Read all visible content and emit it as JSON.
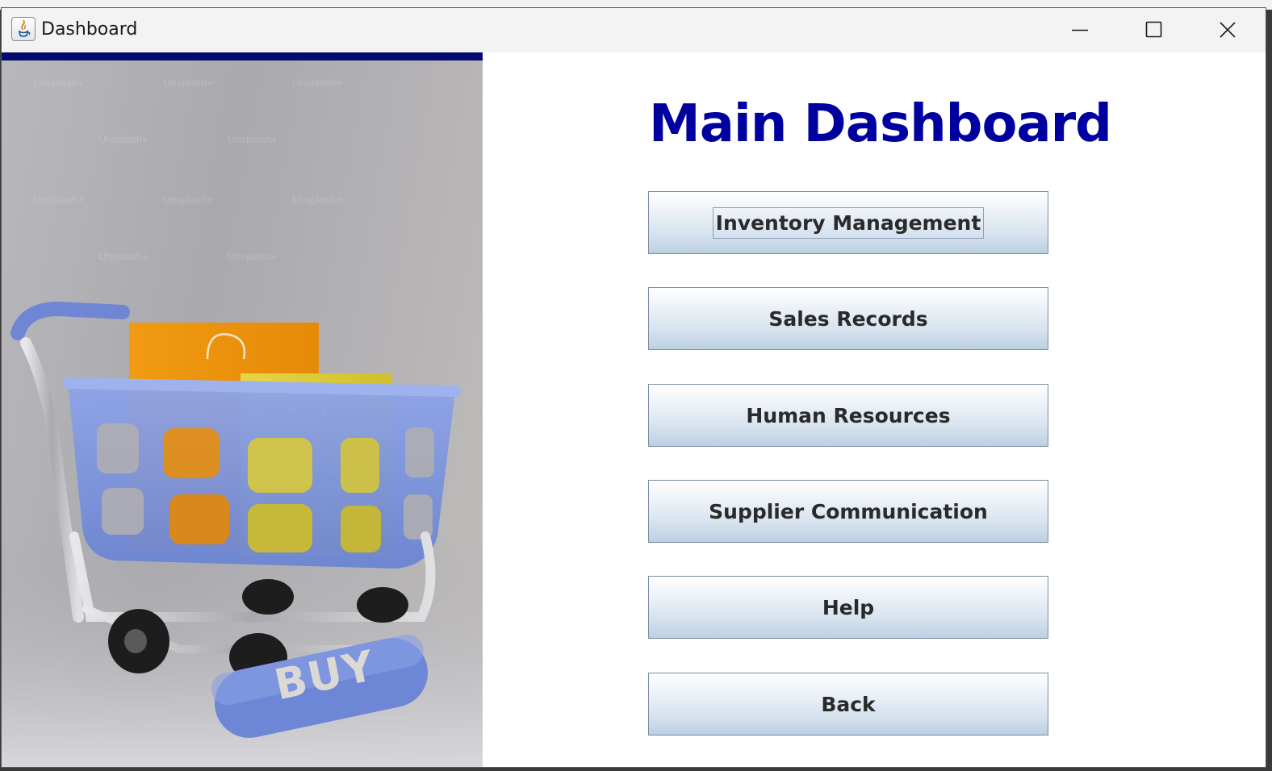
{
  "window": {
    "title": "Dashboard",
    "controls": {
      "minimize_icon": "minimize-icon",
      "maximize_icon": "maximize-icon",
      "close_icon": "close-icon"
    }
  },
  "hero_image": {
    "badge_text": "BUY",
    "watermark": "Unsplash+"
  },
  "main": {
    "title": "Main Dashboard",
    "buttons": [
      {
        "label": "Inventory Management",
        "focused": true
      },
      {
        "label": "Sales Records"
      },
      {
        "label": "Human Resources"
      },
      {
        "label": "Supplier Communication"
      },
      {
        "label": "Help"
      },
      {
        "label": "Back"
      }
    ]
  },
  "colors": {
    "title": "#0000a0",
    "accent_bar": "#050a6e",
    "button_top": "#ffffff",
    "button_bottom": "#bcd0e2"
  }
}
